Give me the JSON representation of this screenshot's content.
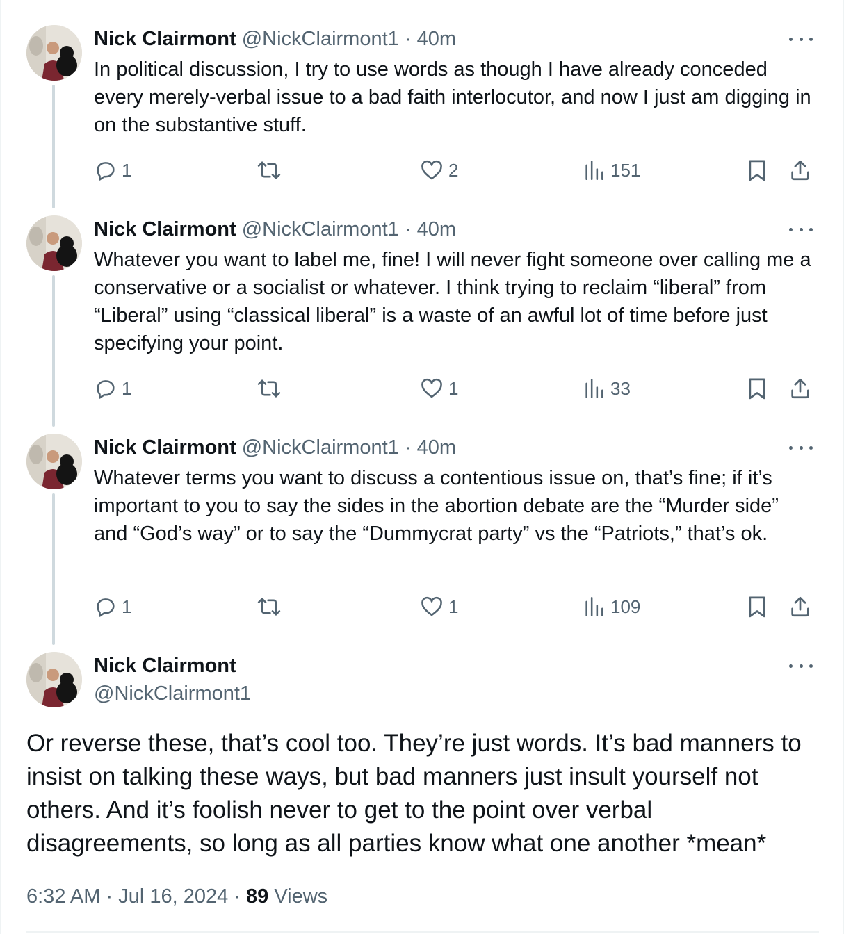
{
  "tweets": [
    {
      "author_name": "Nick Clairmont",
      "handle": "@NickClairmont1",
      "separator": "·",
      "time": "40m",
      "text": "In political discussion, I try to use words as though I have already conceded every merely-verbal issue to a bad faith interlocutor, and now I just am digging in on the substantive stuff.",
      "replies": "1",
      "retweets": "",
      "likes": "2",
      "views": "151"
    },
    {
      "author_name": "Nick Clairmont",
      "handle": "@NickClairmont1",
      "separator": "·",
      "time": "40m",
      "text": "Whatever you want to label me, fine! I will never fight someone over calling me a conservative or a socialist or whatever. I think trying to reclaim “liberal” from “Liberal” using “classical liberal” is a waste of an awful lot of time before just specifying your point.",
      "replies": "1",
      "retweets": "",
      "likes": "1",
      "views": "33"
    },
    {
      "author_name": "Nick Clairmont",
      "handle": "@NickClairmont1",
      "separator": "·",
      "time": "40m",
      "text": "Whatever terms you want to discuss a contentious issue on, that’s fine; if it’s important to you to say the sides in the abortion debate are the “Murder side” and “God’s way” or to say the “Dummycrat party” vs the “Patriots,” that’s ok.",
      "replies": "1",
      "retweets": "",
      "likes": "1",
      "views": "109"
    }
  ],
  "main_tweet": {
    "author_name": "Nick Clairmont",
    "handle": "@NickClairmont1",
    "text": "Or reverse these, that’s cool too. They’re just words. It’s bad manners to insist on talking these ways, but bad manners just insult yourself not others. And it’s foolish never to get to the point over verbal disagreements, so long as all parties know what one another *mean*",
    "time": "6:32 AM",
    "date": "Jul 16, 2024",
    "separator": "·",
    "views_count": "89",
    "views_label": "Views"
  },
  "icons": {
    "reply": "reply-icon",
    "retweet": "retweet-icon",
    "like": "heart-icon",
    "views": "views-chart-icon",
    "bookmark": "bookmark-icon",
    "share": "share-icon",
    "more": "more-dots-icon"
  },
  "colors": {
    "text_primary": "#0f1419",
    "text_secondary": "#536471",
    "thread_line": "#cfd9de",
    "border": "#eff3f4"
  }
}
